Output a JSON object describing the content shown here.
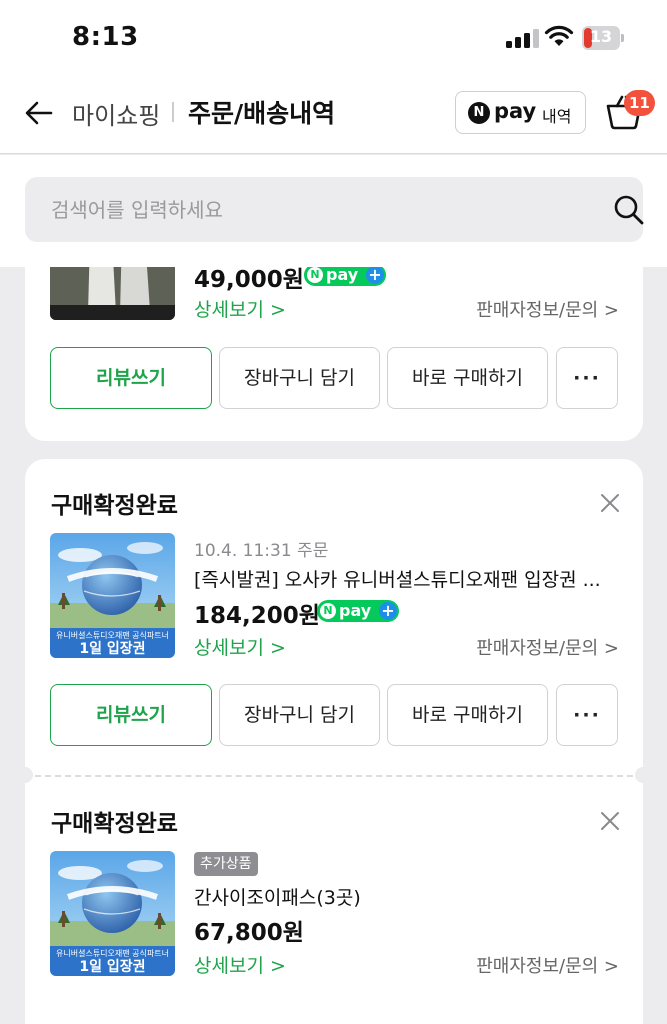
{
  "status_bar": {
    "time": "8:13",
    "battery": "13"
  },
  "header": {
    "back_icon": "arrow-left-icon",
    "breadcrumb_parent": "마이쇼핑",
    "title": "주문/배송내역",
    "npay_logo": "N",
    "npay_pay": "pay",
    "npay_label": "내역",
    "cart_badge": "11"
  },
  "search": {
    "placeholder": "검색어를 입력하세요"
  },
  "orders": [
    {
      "price": "49,000원",
      "detail_link": "상세보기 >",
      "seller_link": "판매자정보/문의 >",
      "buttons": {
        "review": "리뷰쓰기",
        "cart": "장바구니 담기",
        "buy": "바로 구매하기",
        "more": "···"
      }
    },
    {
      "status": "구매확정완료",
      "date": "10.4. 11:31 주문",
      "name": "[즉시발권] 오사카 유니버셜스튜디오재팬 입장권 ...",
      "price": "184,200원",
      "detail_link": "상세보기 >",
      "seller_link": "판매자정보/문의 >",
      "thumb_caption_small": "유니버셜스튜디오재팬 공식파트너",
      "thumb_caption_big": "1일 입장권",
      "buttons": {
        "review": "리뷰쓰기",
        "cart": "장바구니 담기",
        "buy": "바로 구매하기",
        "more": "···"
      }
    },
    {
      "status": "구매확정완료",
      "tag": "추가상품",
      "name": "간사이조이패스(3곳)",
      "price": "67,800원",
      "detail_link": "상세보기 >",
      "seller_link": "판매자정보/문의 >",
      "thumb_caption_small": "유니버셜스튜디오재팬 공식파트너",
      "thumb_caption_big": "1일 입장권"
    }
  ],
  "npay_badge": {
    "n": "N",
    "pay": "pay",
    "plus": "+"
  },
  "colors": {
    "green": "#1fa44b",
    "npay_green": "#05c95a",
    "badge_red": "#f2513c",
    "background": "#ececef"
  }
}
